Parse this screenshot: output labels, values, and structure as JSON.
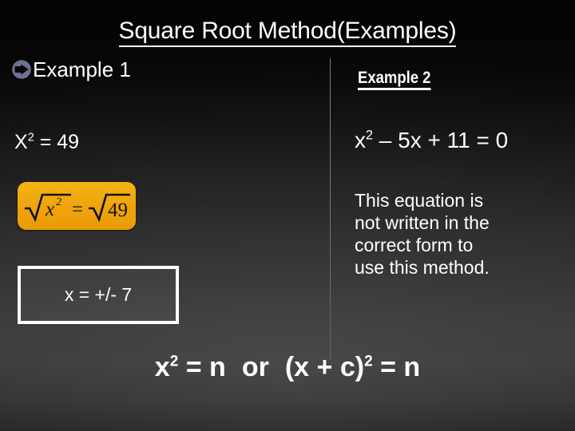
{
  "slide": {
    "title": "Square Root Method(Examples)",
    "background_top_color": "#050505",
    "background_bottom_color": "#3a3a3a",
    "divider_color": "#8c96b9"
  },
  "left_column": {
    "bullet_icon": "arrow-circle-bullet-icon",
    "bullet_color": "#6b7394",
    "heading": "Example 1",
    "equation": {
      "base": "X",
      "exponent": "2",
      "rest": " = 49"
    },
    "radical_box": {
      "background_color": "#f0a50d",
      "expression": "√x² = √49",
      "left_radicand": "x",
      "left_exponent": "2",
      "equals": "=",
      "right_radicand": "49"
    },
    "answer_box": {
      "border_color": "#ffffff",
      "text": "x = +/- 7"
    }
  },
  "right_column": {
    "heading": "Example 2",
    "equation": {
      "base": "x",
      "exponent": "2",
      "rest": " – 5x + 11 = 0"
    },
    "note_lines": [
      "This equation is",
      "not written in the",
      "correct form to",
      "use this method."
    ]
  },
  "bottom_formula": {
    "part1_base": "x",
    "part1_exponent": "2",
    "part1_rest": " = n",
    "conjunction": "or",
    "part2_open": "(x + c)",
    "part2_exponent": "2",
    "part2_rest": " = n"
  }
}
